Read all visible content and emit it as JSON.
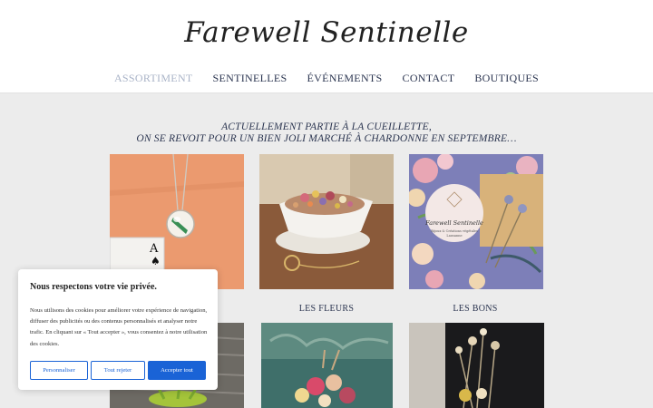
{
  "site": {
    "logo": "Farewell Sentinelle"
  },
  "nav": [
    {
      "label": "ASSORTIMENT",
      "active": true
    },
    {
      "label": "SENTINELLES",
      "active": false
    },
    {
      "label": "ÉVÉNEMENTS",
      "active": false
    },
    {
      "label": "CONTACT",
      "active": false
    },
    {
      "label": "BOUTIQUES",
      "active": false
    }
  ],
  "announcement": {
    "line1": "ACTUELLEMENT PARTIE À LA CUEILLETTE,",
    "line2": "ON SE REVOIT POUR UN BIEN JOLI MARCHÉ À CHARDONNE EN SEPTEMBRE…"
  },
  "products": [
    {
      "caption": ""
    },
    {
      "caption": "LES FLEURS"
    },
    {
      "caption": "LES BONS"
    }
  ],
  "card": {
    "rank": "A",
    "suit": "♠"
  },
  "label": {
    "line1": "Farewell Sentinelle",
    "line2": "Bijoux & Créations végétales",
    "line3": "Lausanne"
  },
  "cookie": {
    "title": "Nous respectons votre vie privée.",
    "text": "Nous utilisons des cookies pour améliorer votre expérience de navigation, diffuser des publicités ou des contenus personnalisés et analyser notre trafic. En cliquant sur « Tout accepter », vous consentez à notre utilisation des cookies.",
    "btn_customize": "Personnaliser",
    "btn_reject": "Tout rejeter",
    "btn_accept": "Accepter tout"
  },
  "colors": {
    "accent": "#1a63d6",
    "text": "#2b3550",
    "nav_active": "#a9b3c7"
  }
}
